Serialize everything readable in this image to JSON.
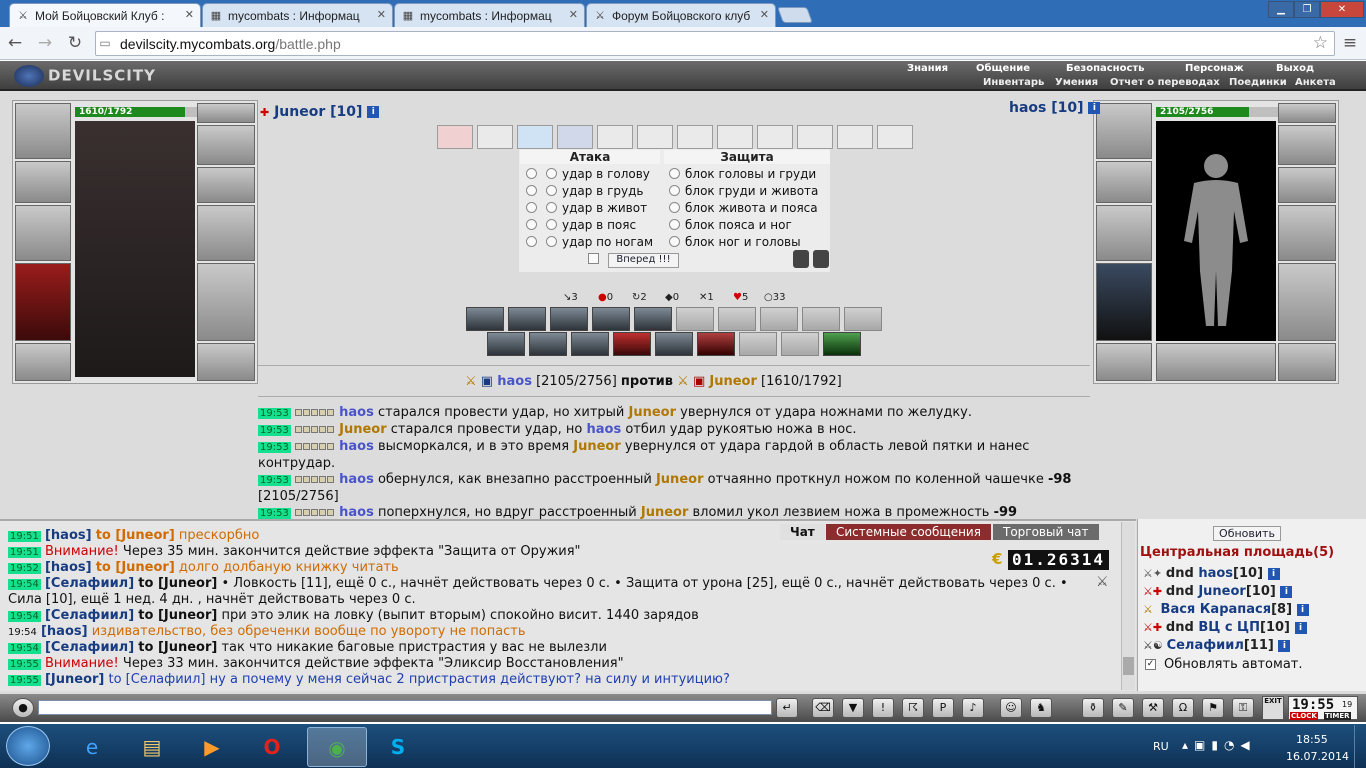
{
  "browser": {
    "tabs": [
      {
        "title": "Мой Бойцовский Клуб :"
      },
      {
        "title": "mycombats : Информац"
      },
      {
        "title": "mycombats : Информац"
      },
      {
        "title": "Форум Бойцовского клуб"
      }
    ],
    "url_host": "devilscity.mycombats.org",
    "url_path": "/battle.php"
  },
  "game": {
    "logo": "DEVILSCITY",
    "nav_top": [
      "Знания",
      "Общение",
      "Безопасность",
      "Персонаж",
      "Выход"
    ],
    "nav_sub": [
      "Инвентарь",
      "Умения",
      "Отчет о переводах",
      "Поединки",
      "Анкета"
    ],
    "player": {
      "name": "Juneor",
      "level": "[10]",
      "hp": "1610/1792",
      "hp_fraction": 0.898
    },
    "opponent": {
      "name": "haos",
      "level": "[10]",
      "hp": "2105/2756",
      "hp_fraction": 0.764
    },
    "attack_title": "Атака",
    "defense_title": "Защита",
    "attacks": [
      "удар в голову",
      "удар в грудь",
      "удар в живот",
      "удар в пояс",
      "удар по ногам"
    ],
    "defenses": [
      "блок головы и груди",
      "блок груди и живота",
      "блок живота и пояса",
      "блок пояса и ног",
      "блок ног и головы"
    ],
    "forward_button": "Вперед !!!",
    "counters": [
      "3",
      "0",
      "2",
      "0",
      "1",
      "5",
      "33"
    ],
    "versus": {
      "left_name": "haos",
      "left_hp": "[2105/2756]",
      "word": "против",
      "right_name": "Juneor",
      "right_hp": "[1610/1792]"
    },
    "log": [
      {
        "time": "19:53",
        "a": "haos",
        "t1": " старался провести удар, но хитрый ",
        "b": "Juneor",
        "t2": " увернулся от удара ножнами по желудку."
      },
      {
        "time": "19:53",
        "a": "Juneor",
        "t1": " старался провести удар, но ",
        "b": "haos",
        "t2": " отбил удар рукоятью ножа в нос."
      },
      {
        "time": "19:53",
        "a": "haos",
        "t1": " высморкался, и в это время ",
        "b": "Juneor",
        "t2": " увернулся от удара гардой в область левой пятки и нанес контрудар."
      },
      {
        "time": "19:53",
        "a": "haos",
        "t1": " обернулся, как внезапно расстроенный ",
        "b": "Juneor",
        "t2": " отчаянно проткнул ножом по коленной чашечке ",
        "dmg": "-98",
        "t3": " [2105/2756]"
      },
      {
        "time": "19:53",
        "a": "haos",
        "t1": " поперхнулся, но вдруг расстроенный ",
        "b": "Juneor",
        "t2": " вломил укол лезвием ножа в промежность ",
        "dmg": "-99",
        "t3": ""
      }
    ]
  },
  "chat": {
    "tabs": [
      "Чат",
      "Системные сообщения",
      "Торговый чат"
    ],
    "money_label": "€",
    "money_value": "01.26314",
    "lines": [
      {
        "time": "19:51",
        "from": "[haos]",
        "to": "to [Juneor]",
        "text": " прескорбно",
        "style": "ora"
      },
      {
        "time": "19:51",
        "from": "Внимание!",
        "to": "",
        "text": " Через 35 мин. закончится действие эффекта \"Защита от Оружия\"",
        "style": "warn"
      },
      {
        "time": "19:52",
        "from": "[haos]",
        "to": "to [Juneor]",
        "text": " долго долбаную книжку читать",
        "style": "ora"
      },
      {
        "time": "19:54",
        "from": "[Селафиил]",
        "to": "to [Juneor]",
        "text": " • Ловкость [11], ещё 0 с., начнёт действовать через 0 с. • Защита от урона [25], ещё 0 с., начнёт действовать через 0 с. •",
        "style": "plain"
      },
      {
        "time": "",
        "from": "",
        "to": "",
        "text": "Сила [10], ещё 1 нед. 4 дн. , начнёт действовать через 0 с.",
        "style": "plain"
      },
      {
        "time": "19:54",
        "from": "[Селафиил]",
        "to": "to [Juneor]",
        "text": " при это элик на ловку (выпит вторым) спокойно висит. 1440 зарядов",
        "style": "plain"
      },
      {
        "time": "19:54",
        "from": "[haos]",
        "to": "",
        "text": " издивательство, без обреченки вообще по увороту не попасть",
        "style": "ora"
      },
      {
        "time": "19:54",
        "from": "[Селафиил]",
        "to": "to [Juneor]",
        "text": " так что никакие баговые пристрастия у вас не вылезли",
        "style": "plain"
      },
      {
        "time": "19:55",
        "from": "Внимание!",
        "to": "",
        "text": " Через 33 мин. закончится действие эффекта \"Эликсир Восстановления\"",
        "style": "warn"
      },
      {
        "time": "19:55",
        "from": "[Juneor]",
        "to": "to [Селафиил]",
        "text": " ну а почему у меня сейчас 2 пристрастия действуют? на силу и интуицию?",
        "style": "blue"
      }
    ]
  },
  "location": {
    "refresh_button": "Обновить",
    "title": "Центральная площадь(5)",
    "players": [
      {
        "prefix": "dnd",
        "name": "haos",
        "level": "[10]"
      },
      {
        "prefix": "dnd",
        "name": "Juneor",
        "level": "[10]"
      },
      {
        "prefix": "",
        "name": "Вася Карапася",
        "level": "[8]"
      },
      {
        "prefix": "dnd",
        "name": "ВЦ с ЦП",
        "level": "[10]"
      },
      {
        "prefix": "",
        "name": "Селафиил",
        "level": "[11]"
      }
    ],
    "auto_refresh_label": "Обновлять автомат."
  },
  "clock": {
    "time": "19:55",
    "seconds": "19",
    "label1": "CLOCK",
    "label2": "TIMER",
    "exit": "EXIT"
  },
  "taskbar": {
    "lang": "RU",
    "time": "18:55",
    "date": "16.07.2014"
  }
}
